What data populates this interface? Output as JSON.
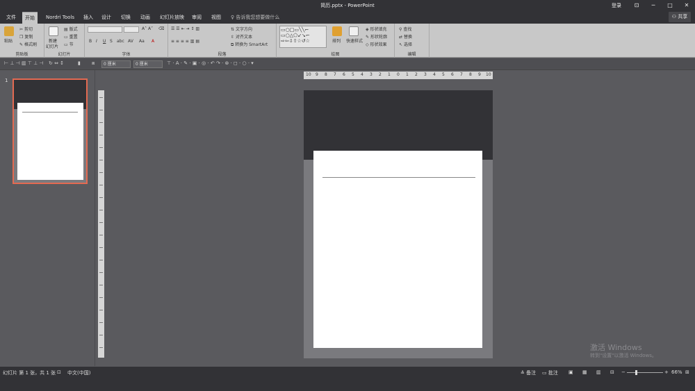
{
  "window": {
    "title": "简历.pptx  -  PowerPoint",
    "login": "登录",
    "min": "─",
    "max": "□",
    "ribbon_opt": "⊡",
    "close": "✕"
  },
  "tabs": [
    {
      "label": "文件"
    },
    {
      "label": "开始"
    },
    {
      "label": "Nordri Tools"
    },
    {
      "label": "插入"
    },
    {
      "label": "设计"
    },
    {
      "label": "切换"
    },
    {
      "label": "动画"
    },
    {
      "label": "幻灯片放映"
    },
    {
      "label": "审阅"
    },
    {
      "label": "视图"
    }
  ],
  "tellme": "告诉我您想要做什么",
  "share": "共享",
  "ribbon": {
    "clipboard": {
      "paste": "粘贴",
      "cut": "剪切",
      "copy": "复制",
      "format_painter": "格式刷",
      "label": "剪贴板"
    },
    "slides": {
      "new_slide": "新建",
      "new_slide2": "幻灯片",
      "layout": "版式",
      "reset": "重置",
      "section": "节",
      "label": "幻灯片"
    },
    "font": {
      "label": "字体"
    },
    "paragraph": {
      "text_direction": "文字方向",
      "align_text": "对齐文本",
      "smartart": "转换为 SmartArt",
      "label": "段落"
    },
    "drawing": {
      "arrange": "排列",
      "quick_styles": "快速样式",
      "fill": "形状填充",
      "outline": "形状轮廓",
      "effects": "形状效果",
      "label": "绘图"
    },
    "editing": {
      "find": "查找",
      "replace": "替换",
      "select": "选择",
      "label": "编辑"
    }
  },
  "drawbar": {
    "width1": "0 厘米",
    "width2": "0 厘米"
  },
  "thumbnail": {
    "number": "1"
  },
  "ruler": {
    "labels": [
      "10",
      "9",
      "8",
      "7",
      "6",
      "5",
      "4",
      "3",
      "2",
      "1",
      "0",
      "1",
      "2",
      "3",
      "4",
      "5",
      "6",
      "7",
      "8",
      "9",
      "10"
    ]
  },
  "watermark": {
    "line1": "激活 Windows",
    "line2": "转到\"设置\"以激活 Windows。"
  },
  "status": {
    "slide_info": "幻灯片 第 1 张，共 1 张",
    "language": "中文(中国)",
    "notes": "备注",
    "comments": "批注",
    "zoom": "66%"
  }
}
